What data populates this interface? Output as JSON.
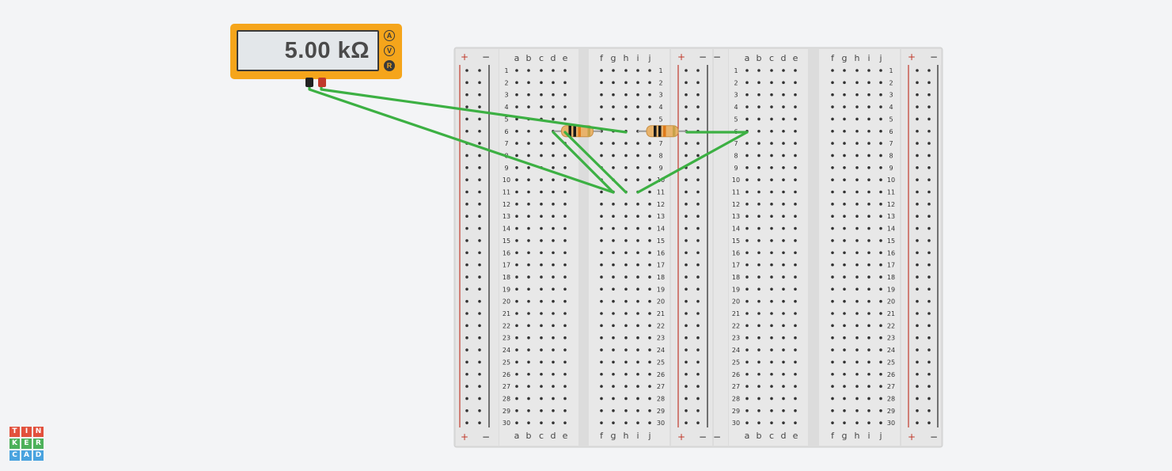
{
  "multimeter": {
    "reading": "5.00 kΩ",
    "modes": [
      {
        "label": "A",
        "active": false
      },
      {
        "label": "V",
        "active": false
      },
      {
        "label": "R",
        "active": true
      }
    ]
  },
  "breadboard": {
    "rows": 30,
    "columns_left": [
      "a",
      "b",
      "c",
      "d",
      "e"
    ],
    "columns_right": [
      "f",
      "g",
      "h",
      "i",
      "j"
    ],
    "rail_plus": "+",
    "rail_minus": "−"
  },
  "components": [
    {
      "type": "resistor",
      "name": "resistor-1"
    },
    {
      "type": "resistor",
      "name": "resistor-2"
    }
  ],
  "wire_color": "#3cb043",
  "logo": {
    "letters": [
      "T",
      "I",
      "N",
      "K",
      "E",
      "R",
      "C",
      "A",
      "D"
    ],
    "colors": [
      "#e2513d",
      "#e2513d",
      "#e2513d",
      "#4db15a",
      "#4db15a",
      "#4db15a",
      "#4aa3df",
      "#4aa3df",
      "#4aa3df"
    ]
  }
}
